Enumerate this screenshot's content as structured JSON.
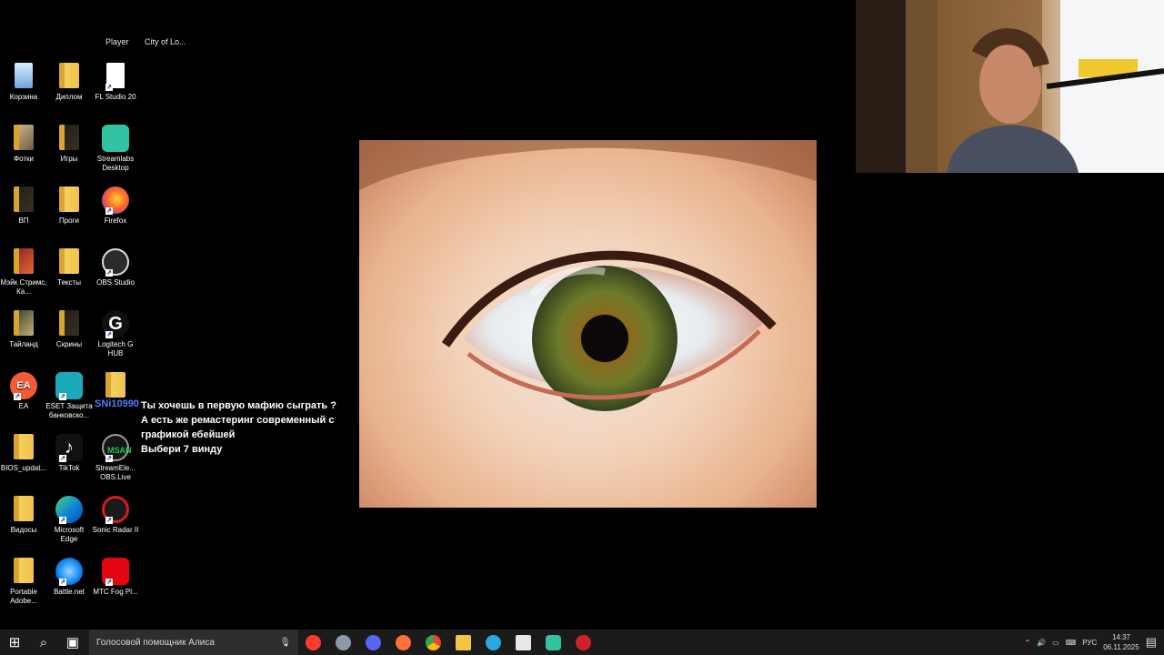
{
  "top_labels": [
    "Player",
    "City of Lo..."
  ],
  "desktop_icons": [
    {
      "label": "Корзина",
      "icon": "recycle-bin-icon"
    },
    {
      "label": "Диплом",
      "icon": "folder-icon"
    },
    {
      "label": "FL Studio 20",
      "icon": "document-icon"
    },
    {
      "label": "Фотки",
      "icon": "folder-icon"
    },
    {
      "label": "Игры",
      "icon": "folder-icon"
    },
    {
      "label": "Streamlabs Desktop",
      "icon": "streamlabs-icon"
    },
    {
      "label": "ВП",
      "icon": "folder-icon"
    },
    {
      "label": "Проги",
      "icon": "folder-icon"
    },
    {
      "label": "Firefox",
      "icon": "firefox-icon"
    },
    {
      "label": "Мэйк Стримс, Ка...",
      "icon": "folder-icon"
    },
    {
      "label": "Тексты",
      "icon": "folder-icon"
    },
    {
      "label": "OBS Studio",
      "icon": "obs-icon"
    },
    {
      "label": "Тайланд",
      "icon": "folder-icon"
    },
    {
      "label": "Скрины",
      "icon": "folder-icon"
    },
    {
      "label": "Logitech G HUB",
      "icon": "logitech-icon"
    },
    {
      "label": "EA",
      "icon": "ea-icon"
    },
    {
      "label": "ESET Защита банковско...",
      "icon": "eset-icon"
    },
    {
      "label": "",
      "icon": "folder-icon"
    },
    {
      "label": "BIOS_updat...",
      "icon": "folder-icon"
    },
    {
      "label": "TikTok",
      "icon": "tiktok-icon"
    },
    {
      "label": "StreamEle... OBS.Live",
      "icon": "streamelements-icon"
    },
    {
      "label": "Видосы",
      "icon": "folder-icon"
    },
    {
      "label": "Microsoft Edge",
      "icon": "edge-icon"
    },
    {
      "label": "Sonic Radar II",
      "icon": "sonic-radar-icon"
    },
    {
      "label": "Portable Adobe...",
      "icon": "folder-icon"
    },
    {
      "label": "Battle.net",
      "icon": "battlenet-icon"
    },
    {
      "label": "МТС Fog Pl...",
      "icon": "mts-icon"
    }
  ],
  "chat": {
    "name": "SNi10990",
    "badge": "MSAN",
    "line1": "Ты хочешь в первую мафию сыграть ? А есть же ремастеринг современный с графикой ебейшей",
    "line2": "Выбери 7 винду"
  },
  "taskbar": {
    "search_placeholder": "Голосовой помощник Алиса",
    "language": "РУС",
    "time": "14:37",
    "date": "06.11.2025"
  },
  "colors": {
    "taskbar_bg": "#1b1b1b",
    "desktop_bg": "#000000",
    "chat_name": "#4f7dff"
  }
}
